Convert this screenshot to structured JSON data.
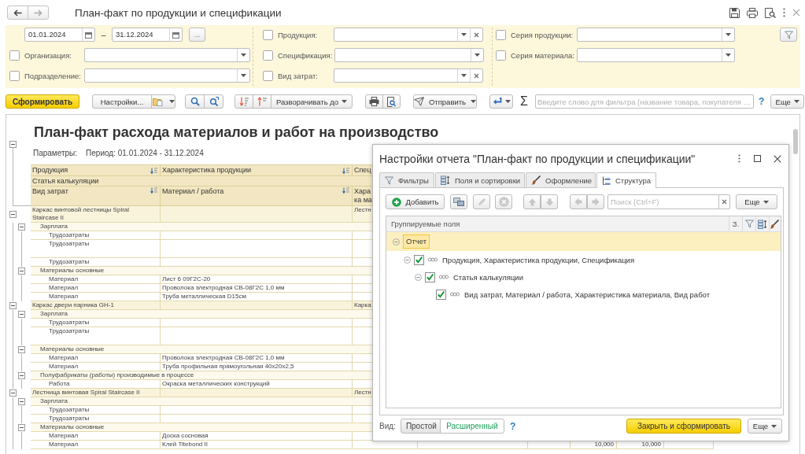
{
  "window": {
    "title": "План-факт по продукции и спецификации"
  },
  "filters": {
    "period": {
      "from": "01.01.2024",
      "separator": "–",
      "to": "31.12.2024",
      "more": "..."
    },
    "columns": [
      [
        {
          "label": "Организация:",
          "checked": false,
          "clear_button": false
        },
        {
          "label": "Подразделение:",
          "checked": false,
          "clear_button": false
        }
      ],
      [
        {
          "label": "Продукция:",
          "checked": false,
          "clear_button": true
        },
        {
          "label": "Спецификация:",
          "checked": false,
          "clear_button": false
        },
        {
          "label": "Вид затрат:",
          "checked": false,
          "clear_button": true
        }
      ],
      [
        {
          "label": "Серия продукции:",
          "checked": false,
          "clear_button": false
        },
        {
          "label": "Серия материала:",
          "checked": false,
          "clear_button": false
        }
      ]
    ]
  },
  "toolbar": {
    "generate": "Сформировать",
    "settings": "Настройки...",
    "expand_to": "Разворачивать до",
    "send": "Отправить",
    "sum": "Σ",
    "search": {
      "placeholder": "Введите слово для фильтра (название товара, покупателя …"
    },
    "help": "?",
    "more": "Еще"
  },
  "report": {
    "expanded": true,
    "title": "План-факт расхода материалов и работ на производство",
    "parameters_label": "Параметры:",
    "period": "Период: 01.01.2024 - 31.12.2024",
    "header": {
      "row_1": [
        {
          "text": "Продукция",
          "sort": true
        },
        {
          "text": "Характеристика продукции",
          "sort": true
        },
        {
          "text": "Спец"
        }
      ],
      "row_2": "Статья калькуляции",
      "row_3": [
        {
          "text": "Вид затрат",
          "sort": true
        },
        {
          "text": "Материал / работа",
          "sort": true
        },
        {
          "lines": [
            "Хара",
            "ка ма"
          ]
        }
      ]
    },
    "rows": [
      {
        "name": "Каркас винтовой лестницы Spiral Staircase II",
        "column_3": "Лестн",
        "expanded": true,
        "children": [
          {
            "name": "Зарплата",
            "expanded": true,
            "children": [
              {
                "name": "Трудозатраты"
              },
              {
                "name": "Трудозатраты"
              },
              {
                "name": "Трудозатраты"
              }
            ]
          },
          {
            "name": "Материалы основные",
            "expanded": true,
            "children": [
              {
                "name": "Материал",
                "material": "Лист 6 09Г2С-20"
              },
              {
                "name": "Материал",
                "material": "Проволока электродная СВ-08Г2С 1,0 мм"
              },
              {
                "name": "Материал",
                "material": "Труба металлическая D15см"
              }
            ]
          }
        ]
      },
      {
        "name": "Каркас двери парника GH-1",
        "column_3": "Карка",
        "expanded": true,
        "children": [
          {
            "name": "Зарплата",
            "expanded": true,
            "children": [
              {
                "name": "Трудозатраты"
              },
              {
                "name": "Трудозатраты"
              }
            ]
          },
          {
            "name": "Материалы основные",
            "expanded": true,
            "children": [
              {
                "name": "Материал",
                "material": "Проволока электродная СВ-08Г2С 1,0 мм"
              },
              {
                "name": "Материал",
                "material": "Труба профильная прямоугольная 40х20х2,5"
              }
            ]
          },
          {
            "name": "Полуфабрикаты (работы) производимые в процессе",
            "expanded": true,
            "children": [
              {
                "name": "Работа",
                "material": "Окраска металлических конструкций"
              }
            ]
          }
        ]
      },
      {
        "name": "Лестница винтовая Spiral Staircase II",
        "column_3": "Лестн",
        "expanded": true,
        "children": [
          {
            "name": "Зарплата",
            "expanded": true,
            "children": [
              {
                "name": "Трудозатраты"
              },
              {
                "name": "Трудозатраты"
              }
            ]
          },
          {
            "name": "Материалы основные",
            "expanded": true,
            "children": [
              {
                "name": "Материал",
                "material": "Доска сосновая"
              },
              {
                "name": "Материал",
                "material": "Клей Titebond II",
                "column_6": "10,000",
                "column_7": "10,000"
              }
            ]
          }
        ]
      }
    ]
  },
  "dialog": {
    "title": "Настройки отчета \"План-факт по продукции и спецификации\"",
    "tabs": [
      {
        "label": "Фильтры",
        "selected": false
      },
      {
        "label": "Поля и сортировки",
        "selected": false
      },
      {
        "label": "Оформление",
        "selected": false
      },
      {
        "label": "Структура",
        "selected": true
      }
    ],
    "toolbar": {
      "add": "Добавить",
      "tools": [
        {
          "disabled": false
        },
        {
          "disabled": true
        },
        {
          "disabled": true
        },
        {
          "disabled": true
        },
        {
          "disabled": true
        },
        {
          "disabled": true
        },
        {
          "disabled": true
        }
      ],
      "search": {
        "placeholder": "Поиск (Ctrl+F)"
      },
      "more": "Еще"
    },
    "tree": {
      "columns": [
        "Группируемые поля",
        "З."
      ],
      "rows": [
        {
          "label": "Отчет",
          "kind": "report",
          "selected": true,
          "expanded": true,
          "children": [
            {
              "label": "Продукция, Характеристика продукции, Спецификация",
              "kind": "grouping",
              "checked": true,
              "selected": false,
              "expanded": true,
              "children": [
                {
                  "label": "Статья калькуляции",
                  "kind": "grouping",
                  "checked": true,
                  "selected": false,
                  "expanded": true,
                  "children": [
                    {
                      "label": "Вид затрат, Материал / работа, Характеристика материала, Вид работ",
                      "kind": "grouping",
                      "checked": true,
                      "selected": false
                    }
                  ]
                }
              ]
            }
          ]
        }
      ]
    },
    "footer": {
      "view_label": "Вид:",
      "modes": [
        {
          "label": "Простой",
          "selected": false
        },
        {
          "label": "Расширенный",
          "selected": true
        }
      ],
      "help": "?",
      "submit": "Закрыть и сформировать",
      "more": "Еще"
    }
  }
}
